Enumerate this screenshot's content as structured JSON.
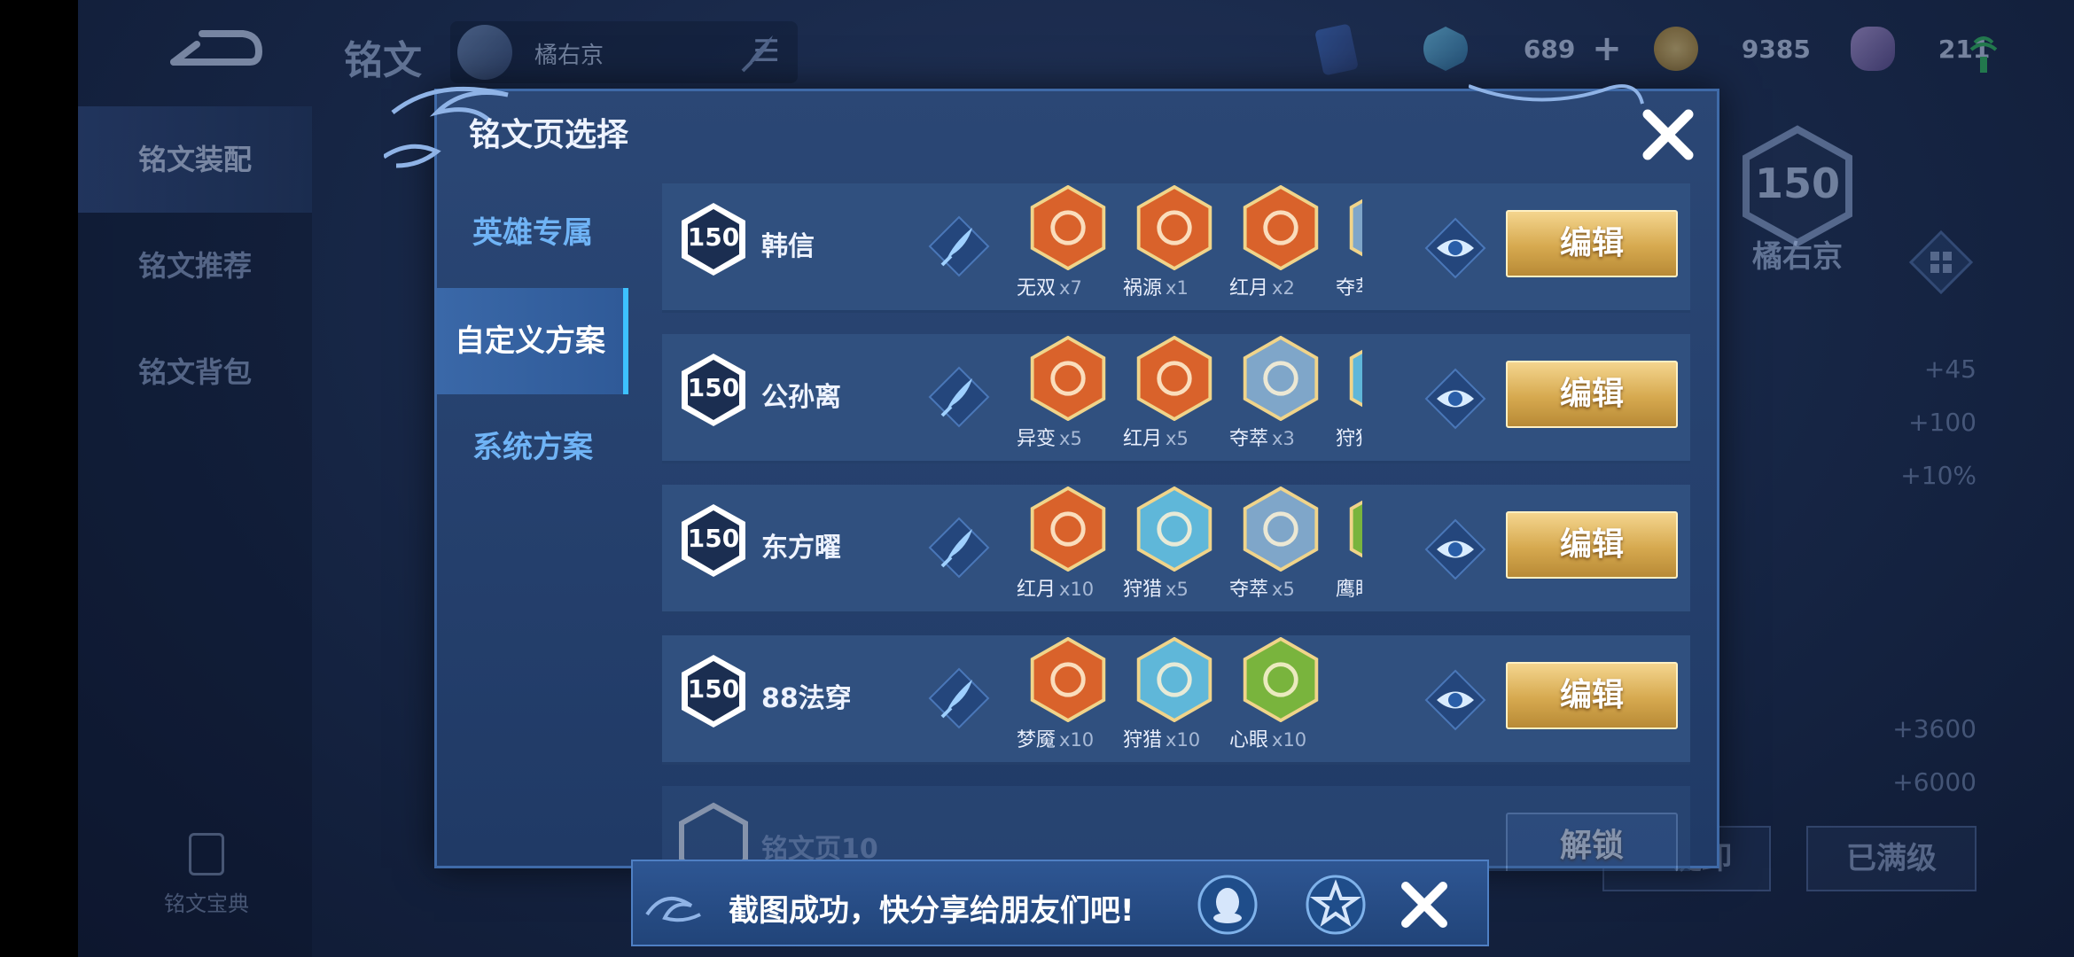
{
  "top_bar": {
    "title": "铭文",
    "hero_name": "橘右京",
    "currencies": [
      {
        "name": "diamond",
        "icon": "blue-crystal-icon",
        "value": "689"
      },
      {
        "name": "gold",
        "icon": "gold-coin-icon",
        "value": "9385"
      },
      {
        "name": "gem",
        "icon": "purple-gem-icon",
        "value": "211"
      }
    ]
  },
  "left_nav": {
    "items": [
      "铭文装配",
      "铭文推荐",
      "铭文背包"
    ],
    "codex_label": "铭文宝典"
  },
  "right_panel": {
    "level": "150",
    "hero_name": "橘右京",
    "stats": [
      "+45",
      "+100",
      "+10%",
      "+3600",
      "+6000"
    ],
    "btn_unload": "一键卸",
    "btn_maxed": "已满级"
  },
  "dialog": {
    "title": "铭文页选择",
    "tabs": [
      "英雄专属",
      "自定义方案",
      "系统方案"
    ],
    "active_tab": 1,
    "edit_label": "编辑",
    "unlock_label": "解锁",
    "rows": [
      {
        "level": "150",
        "name": "韩信",
        "runes": [
          {
            "name": "无双",
            "count": "x7",
            "color": "#d9622b"
          },
          {
            "name": "祸源",
            "count": "x1",
            "color": "#d9622b"
          },
          {
            "name": "红月",
            "count": "x2",
            "color": "#d9622b"
          },
          {
            "name": "夺萃",
            "count": "",
            "color": "#7fa6c9"
          }
        ]
      },
      {
        "level": "150",
        "name": "公孙离",
        "runes": [
          {
            "name": "异变",
            "count": "x5",
            "color": "#d9622b"
          },
          {
            "name": "红月",
            "count": "x5",
            "color": "#d9622b"
          },
          {
            "name": "夺萃",
            "count": "x3",
            "color": "#7fa6c9"
          },
          {
            "name": "狩猎",
            "count": "",
            "color": "#5fb7d9"
          }
        ]
      },
      {
        "level": "150",
        "name": "东方曜",
        "runes": [
          {
            "name": "红月",
            "count": "x10",
            "color": "#d9622b"
          },
          {
            "name": "狩猎",
            "count": "x5",
            "color": "#5fb7d9"
          },
          {
            "name": "夺萃",
            "count": "x5",
            "color": "#7fa6c9"
          },
          {
            "name": "鹰眼",
            "count": "",
            "color": "#79b43d"
          }
        ]
      },
      {
        "level": "150",
        "name": "88法穿",
        "runes": [
          {
            "name": "梦魇",
            "count": "x10",
            "color": "#d9622b"
          },
          {
            "name": "狩猎",
            "count": "x10",
            "color": "#5fb7d9"
          },
          {
            "name": "心眼",
            "count": "x10",
            "color": "#79b43d"
          }
        ]
      }
    ],
    "locked_row_name": "铭文页10"
  },
  "toast": {
    "text": "截图成功，快分享给朋友们吧!"
  }
}
